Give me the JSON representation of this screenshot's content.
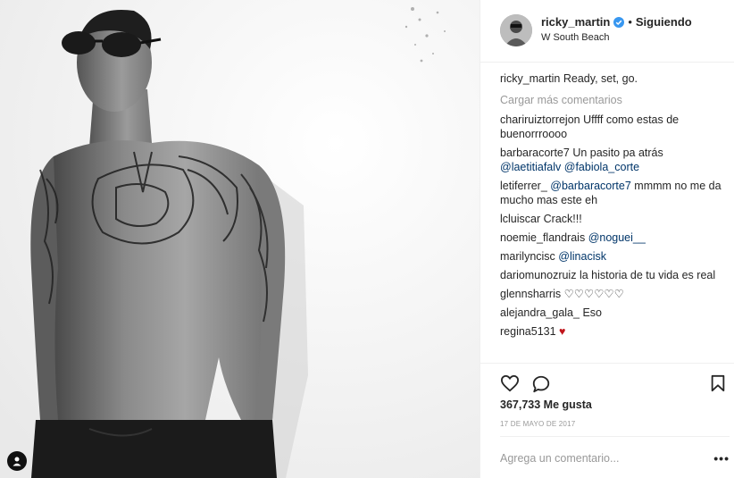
{
  "post": {
    "username": "ricky_martin",
    "follow_separator": "•",
    "follow_status": "Siguiendo",
    "location": "W South Beach",
    "caption": {
      "user": "ricky_martin",
      "text": "Ready, set, go."
    },
    "load_more": "Cargar más comentarios",
    "comments": [
      {
        "user": "chariruiztorrejon",
        "text": "Uffff como estas de buenorrroooo"
      },
      {
        "user": "barbaracorte7",
        "text": "Un pasito pa atrás",
        "mentions": [
          "@laetitiafalv",
          "@fabiola_corte"
        ]
      },
      {
        "user": "letiferrer_",
        "mention": "@barbaracorte7",
        "text": "mmmm no me da mucho mas este eh"
      },
      {
        "user": "lcluiscar",
        "text": "Crack!!!"
      },
      {
        "user": "noemie_flandrais",
        "mention": "@noguei__"
      },
      {
        "user": "marilyncisc",
        "mention": "@linacisk"
      },
      {
        "user": "dariomunozruiz",
        "text": "la historia de tu vida es real"
      },
      {
        "user": "glennsharris",
        "text": "♡♡♡♡♡♡"
      },
      {
        "user": "alejandra_gala_",
        "text": "Eso"
      },
      {
        "user": "regina5131",
        "text": "♥"
      }
    ],
    "likes_text": "367,733 Me gusta",
    "date": "17 DE MAYO DE 2017",
    "comment_placeholder": "Agrega un comentario...",
    "more_label": "•••"
  },
  "icons": {
    "like": "heart-outline-icon",
    "comment": "speech-bubble-icon",
    "save": "bookmark-icon",
    "verified": "verified-badge-icon",
    "user_tag": "person-icon"
  },
  "colors": {
    "text": "#262626",
    "muted": "#999999",
    "mention": "#003569",
    "verified": "#3897f0",
    "heart": "#c0151b",
    "border": "#efefef"
  }
}
